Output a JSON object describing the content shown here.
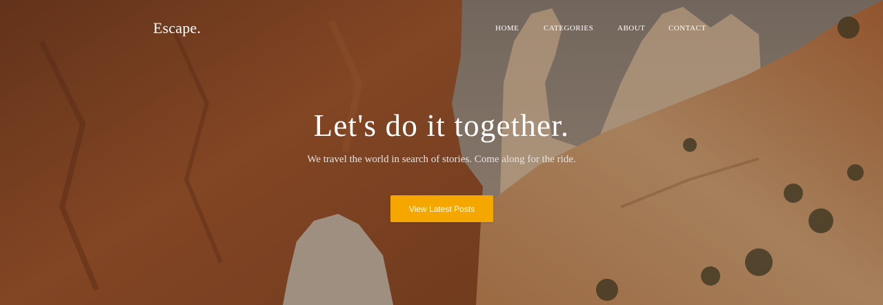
{
  "header": {
    "logo": "Escape.",
    "nav": [
      {
        "label": "HOME"
      },
      {
        "label": "CATEGORIES"
      },
      {
        "label": "ABOUT"
      },
      {
        "label": "CONTACT"
      }
    ]
  },
  "hero": {
    "headline": "Let's do it together.",
    "subtitle": "We travel the world in search of stories. Come along for the ride.",
    "cta_label": "View Latest Posts",
    "background": "canyon rock arch landscape photo"
  },
  "colors": {
    "accent": "#f5a700",
    "text": "#ffffff"
  }
}
